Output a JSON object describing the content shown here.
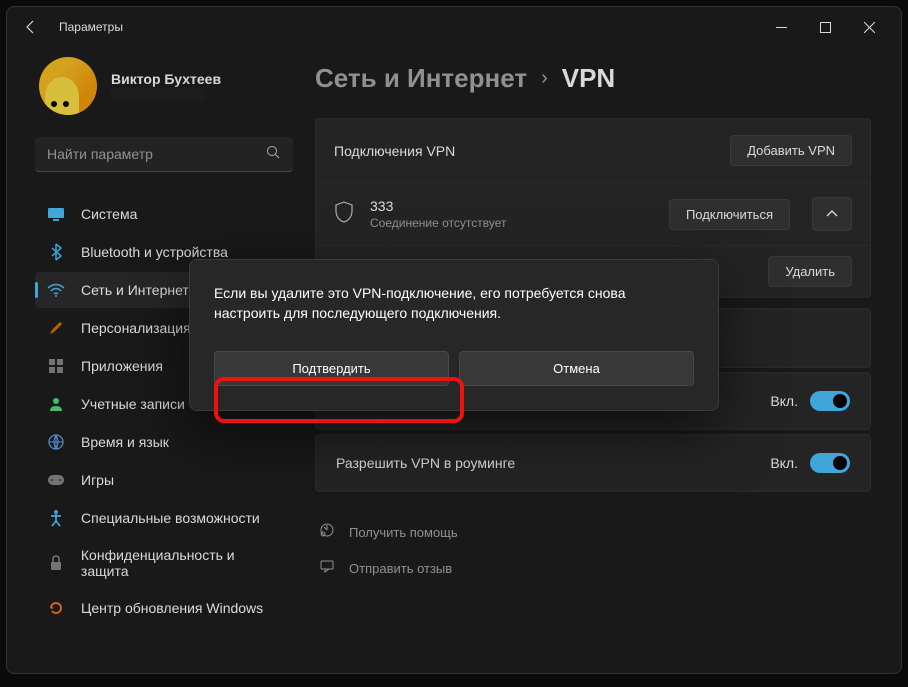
{
  "titlebar": {
    "title": "Параметры"
  },
  "profile": {
    "name": "Виктор Бухтеев"
  },
  "search": {
    "placeholder": "Найти параметр"
  },
  "nav": {
    "items": [
      {
        "label": "Система",
        "icon": "🖥️",
        "color": "#4cc2ff"
      },
      {
        "label": "Bluetooth и устройства",
        "icon": "bt",
        "color": "#4cc2ff"
      },
      {
        "label": "Сеть и Интернет",
        "icon": "wifi",
        "color": "#4cc2ff"
      },
      {
        "label": "Персонализация",
        "icon": "🖌️",
        "color": "#d97706"
      },
      {
        "label": "Приложения",
        "icon": "▦",
        "color": "#888"
      },
      {
        "label": "Учетные записи",
        "icon": "👤",
        "color": "#4ade80"
      },
      {
        "label": "Время и язык",
        "icon": "🌐",
        "color": "#60a5fa"
      },
      {
        "label": "Игры",
        "icon": "🎮",
        "color": "#888"
      },
      {
        "label": "Специальные возможности",
        "icon": "acc",
        "color": "#4cc2ff"
      },
      {
        "label": "Конфиденциальность и защита",
        "icon": "🔒",
        "color": "#888"
      },
      {
        "label": "Центр обновления Windows",
        "icon": "↻",
        "color": "#f97316"
      }
    ]
  },
  "breadcrumb": {
    "parent": "Сеть и Интернет",
    "current": "VPN"
  },
  "vpn": {
    "section_title": "Подключения VPN",
    "add_button": "Добавить VPN",
    "connection": {
      "name": "333",
      "status": "Соединение отсутствует"
    },
    "connect_button": "Подключиться",
    "delete_button": "Удалить"
  },
  "settings": {
    "roaming_label": "Разрешить VPN в роуминге",
    "toggle_on": "Вкл."
  },
  "links": {
    "help": "Получить помощь",
    "feedback": "Отправить отзыв"
  },
  "dialog": {
    "message": "Если вы удалите это VPN-подключение, его потребуется снова настроить для последующего подключения.",
    "confirm": "Подтвердить",
    "cancel": "Отмена"
  }
}
